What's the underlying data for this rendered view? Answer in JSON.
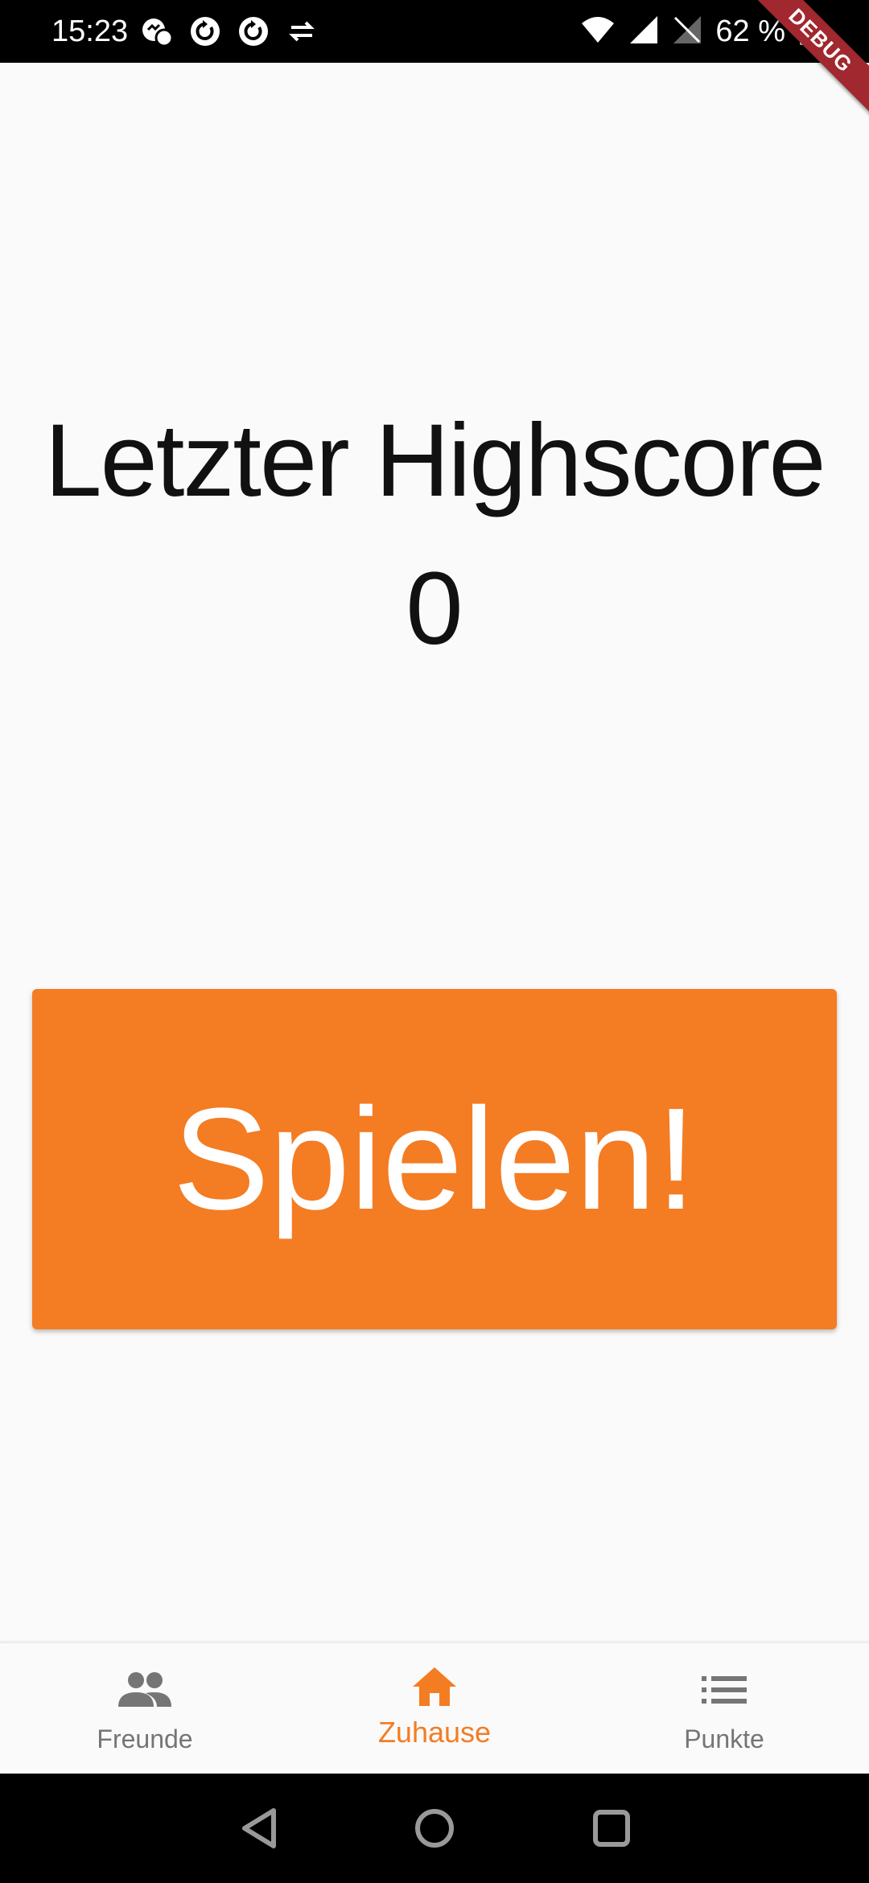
{
  "status_bar": {
    "time": "15:23",
    "battery": "62 %",
    "left_icons": [
      "messenger-icon",
      "sync-icon",
      "sync-icon",
      "data-transfer-icon"
    ],
    "right_icons": [
      "wifi-icon",
      "cell-signal-icon",
      "no-sim-icon",
      "battery-icon"
    ]
  },
  "debug_banner": "DEBUG",
  "home": {
    "highscore_label": "Letzter Highscore",
    "highscore_value": "0",
    "play_button": "Spielen!"
  },
  "bottom_nav": {
    "items": [
      {
        "label": "Freunde",
        "icon": "people-icon",
        "active": false
      },
      {
        "label": "Zuhause",
        "icon": "home-icon",
        "active": true
      },
      {
        "label": "Punkte",
        "icon": "list-icon",
        "active": false
      }
    ]
  },
  "colors": {
    "accent": "#f47c23",
    "inactive": "#757575",
    "background": "#fafafa",
    "debug_banner": "#a0282e"
  },
  "system_nav": {
    "buttons": [
      "back-icon",
      "home-circle-icon",
      "recents-icon"
    ]
  }
}
